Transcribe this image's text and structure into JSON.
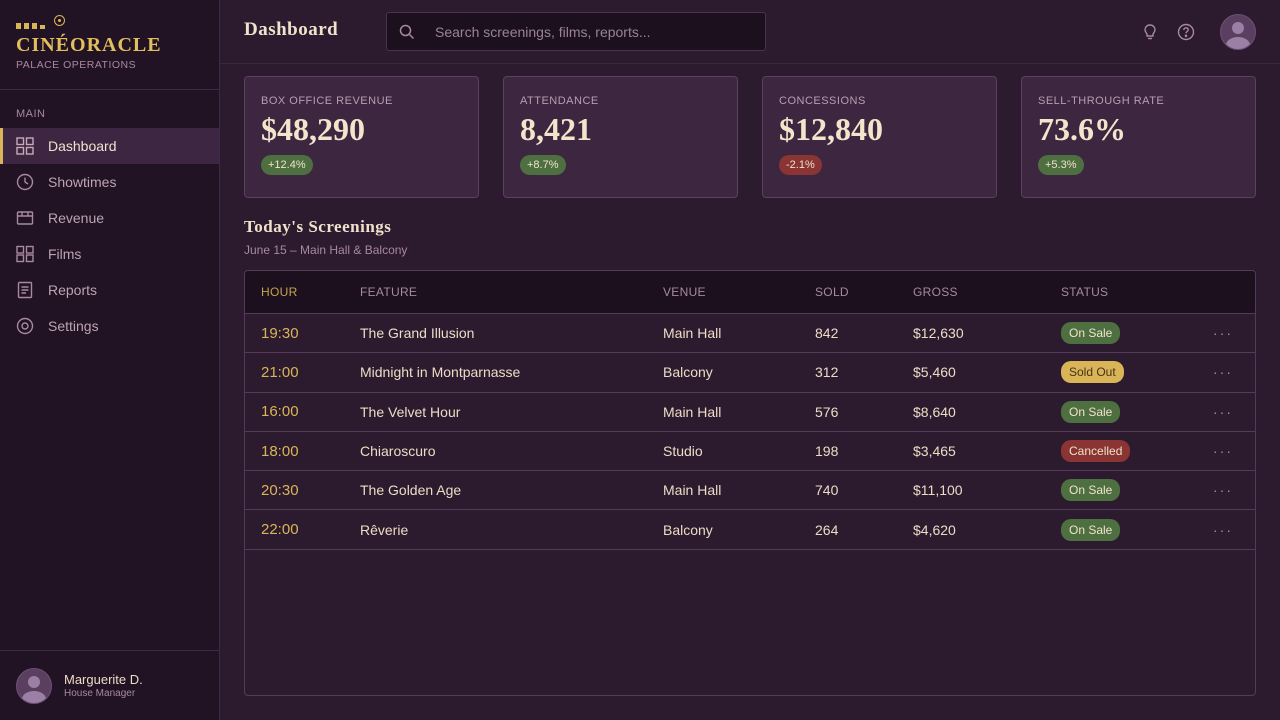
{
  "brand": {
    "name": "CINÉORACLE",
    "subtitle": "PALACE OPERATIONS"
  },
  "sidebar": {
    "section": "MAIN",
    "items": [
      {
        "label": "Dashboard",
        "icon": "grid-icon",
        "active": true
      },
      {
        "label": "Showtimes",
        "icon": "clock-icon"
      },
      {
        "label": "Revenue",
        "icon": "ticket-icon"
      },
      {
        "label": "Films",
        "icon": "film-grid-icon"
      },
      {
        "label": "Reports",
        "icon": "report-icon"
      },
      {
        "label": "Settings",
        "icon": "gear-icon"
      }
    ]
  },
  "user": {
    "name": "Marguerite D.",
    "role": "House Manager"
  },
  "header": {
    "title": "Dashboard",
    "search_placeholder": "Search screenings, films, reports..."
  },
  "stats": [
    {
      "label": "BOX OFFICE REVENUE",
      "value": "$48,290",
      "delta": "+12.4%",
      "trend": "up"
    },
    {
      "label": "ATTENDANCE",
      "value": "8,421",
      "delta": "+8.7%",
      "trend": "up"
    },
    {
      "label": "CONCESSIONS",
      "value": "$12,840",
      "delta": "-2.1%",
      "trend": "down"
    },
    {
      "label": "SELL-THROUGH RATE",
      "value": "73.6%",
      "delta": "+5.3%",
      "trend": "up"
    }
  ],
  "screenings": {
    "title": "Today's Screenings",
    "subtitle": "June 15 – Main Hall & Balcony",
    "columns": [
      "HOUR",
      "FEATURE",
      "VENUE",
      "SOLD",
      "GROSS",
      "STATUS"
    ],
    "rows": [
      {
        "hour": "19:30",
        "feature": "The Grand Illusion",
        "venue": "Main Hall",
        "sold": "842",
        "gross": "$12,630",
        "status": "On Sale"
      },
      {
        "hour": "21:00",
        "feature": "Midnight in Montparnasse",
        "venue": "Balcony",
        "sold": "312",
        "gross": "$5,460",
        "status": "Sold Out"
      },
      {
        "hour": "16:00",
        "feature": "The Velvet Hour",
        "venue": "Main Hall",
        "sold": "576",
        "gross": "$8,640",
        "status": "On Sale"
      },
      {
        "hour": "18:00",
        "feature": "Chiaroscuro",
        "venue": "Studio",
        "sold": "198",
        "gross": "$3,465",
        "status": "Cancelled"
      },
      {
        "hour": "20:30",
        "feature": "The Golden Age",
        "venue": "Main Hall",
        "sold": "740",
        "gross": "$11,100",
        "status": "On Sale"
      },
      {
        "hour": "22:00",
        "feature": "Rêverie",
        "venue": "Balcony",
        "sold": "264",
        "gross": "$4,620",
        "status": "On Sale"
      }
    ],
    "more_label": "···"
  },
  "colors": {
    "accent": "#d9b558",
    "bg": "#2c1b2f",
    "sidebar": "#211323",
    "positive": "#4e7040",
    "negative": "#8a3434"
  }
}
